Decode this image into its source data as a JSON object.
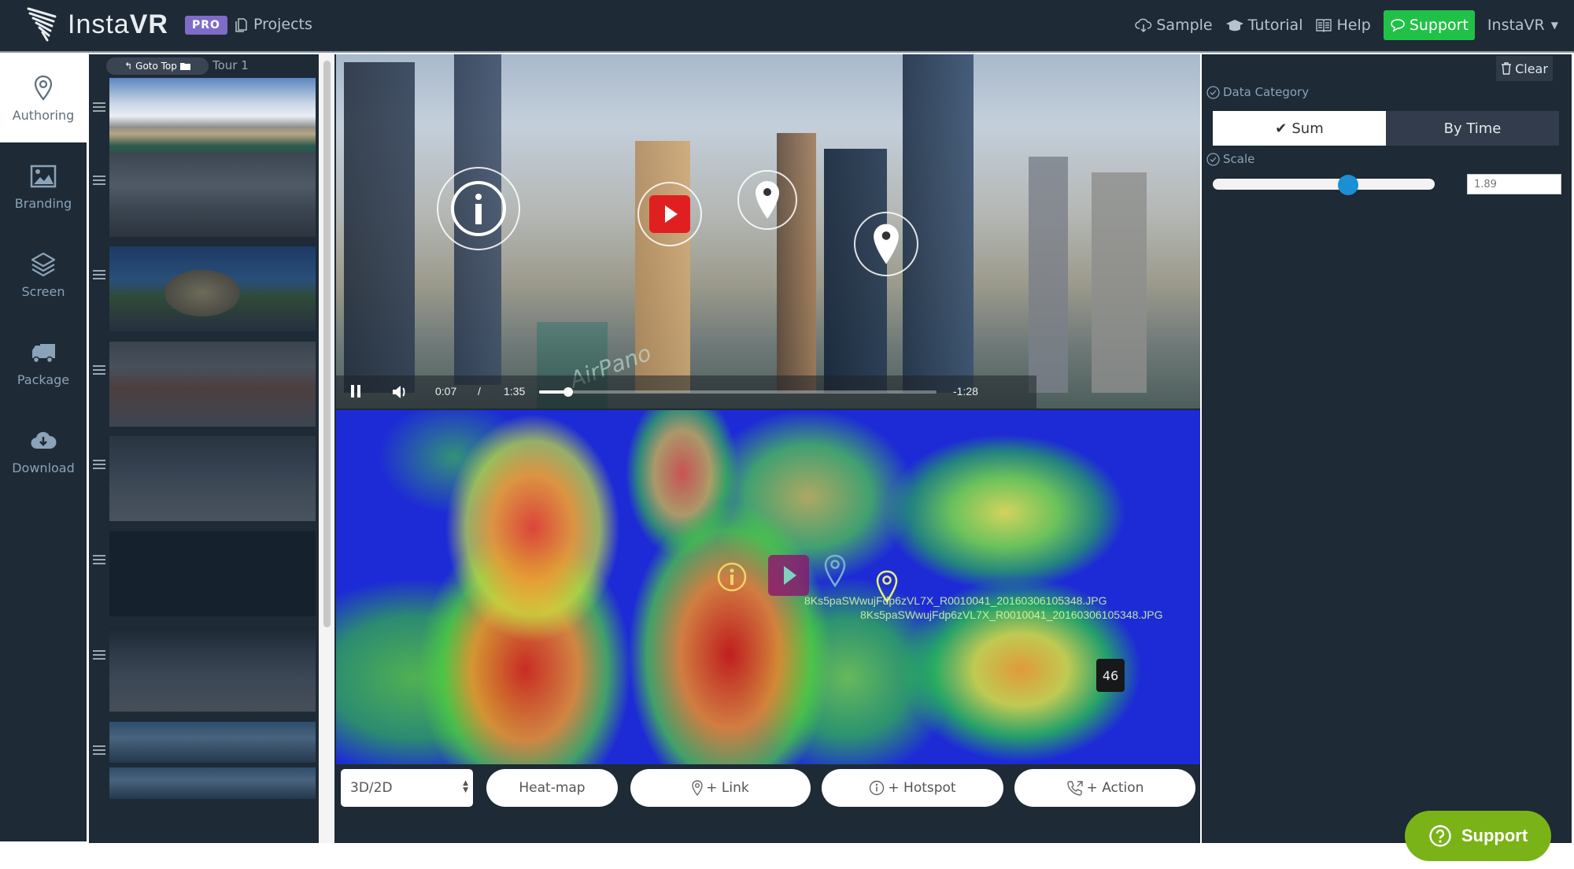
{
  "header": {
    "brand_light": "Insta",
    "brand_bold": "VR",
    "badge": "PRO",
    "projects_label": "Projects",
    "nav": [
      {
        "label": "Sample",
        "icon": "cloud-download-icon"
      },
      {
        "label": "Tutorial",
        "icon": "graduation-cap-icon"
      },
      {
        "label": "Help",
        "icon": "book-icon"
      },
      {
        "label": "Support",
        "icon": "chat-bubble-icon"
      },
      {
        "label": "InstaVR",
        "icon": "caret-down-icon"
      }
    ],
    "colors": {
      "bar": "#1e2a35",
      "support": "#21c148",
      "pro": "#7f6cc9"
    }
  },
  "sidebar": {
    "items": [
      {
        "label": "Authoring",
        "icon": "map-pin-icon",
        "active": true
      },
      {
        "label": "Branding",
        "icon": "image-icon",
        "active": false
      },
      {
        "label": "Screen",
        "icon": "layers-icon",
        "active": false
      },
      {
        "label": "Package",
        "icon": "truck-icon",
        "active": false
      },
      {
        "label": "Download",
        "icon": "cloud-download-icon",
        "active": false
      }
    ]
  },
  "tour": {
    "goto_top_label": "Goto Top",
    "name": "Tour 1",
    "scenes": [
      {
        "desc": "Dubai marina skyline panorama"
      },
      {
        "desc": "Car interior panorama"
      },
      {
        "desc": "Domed building in field panorama"
      },
      {
        "desc": "Ornate room interior panorama"
      },
      {
        "desc": "Event hall panorama"
      },
      {
        "desc": "Empty scene"
      },
      {
        "desc": "Conference hall panorama with speaker"
      },
      {
        "desc": "Blue gradient scene"
      },
      {
        "desc": "Blue gradient scene"
      }
    ]
  },
  "player": {
    "current_time": "0:07",
    "separator": "/",
    "duration": "1:35",
    "remaining": "-1:28",
    "progress_fraction": 0.074,
    "watermark": "AirPano",
    "hotspots": [
      {
        "type": "info",
        "icon": "info-icon"
      },
      {
        "type": "video",
        "icon": "play-icon"
      },
      {
        "type": "link",
        "icon": "map-pin-icon"
      },
      {
        "type": "link",
        "icon": "map-pin-icon"
      }
    ]
  },
  "heatmap": {
    "filename_1": "8Ks5paSWwujFdp6zVL7X_R0010041_20160306105348.JPG",
    "filename_2": "8Ks5paSWwujFdp6zVL7X_R0010041_20160306105348.JPG",
    "count": "46"
  },
  "toolbar": {
    "mode_select_value": "3D/2D",
    "heatmap_label": "Heat-map",
    "link_label": "+ Link",
    "hotspot_label": "+ Hotspot",
    "action_label": "+ Action"
  },
  "panel": {
    "clear_label": "Clear",
    "data_category_label": "Data Category",
    "sum_label": "Sum",
    "by_time_label": "By Time",
    "scale_label": "Scale",
    "scale_value": "1.89",
    "scale_slider_fraction": 0.61
  },
  "float_support_label": "Support"
}
